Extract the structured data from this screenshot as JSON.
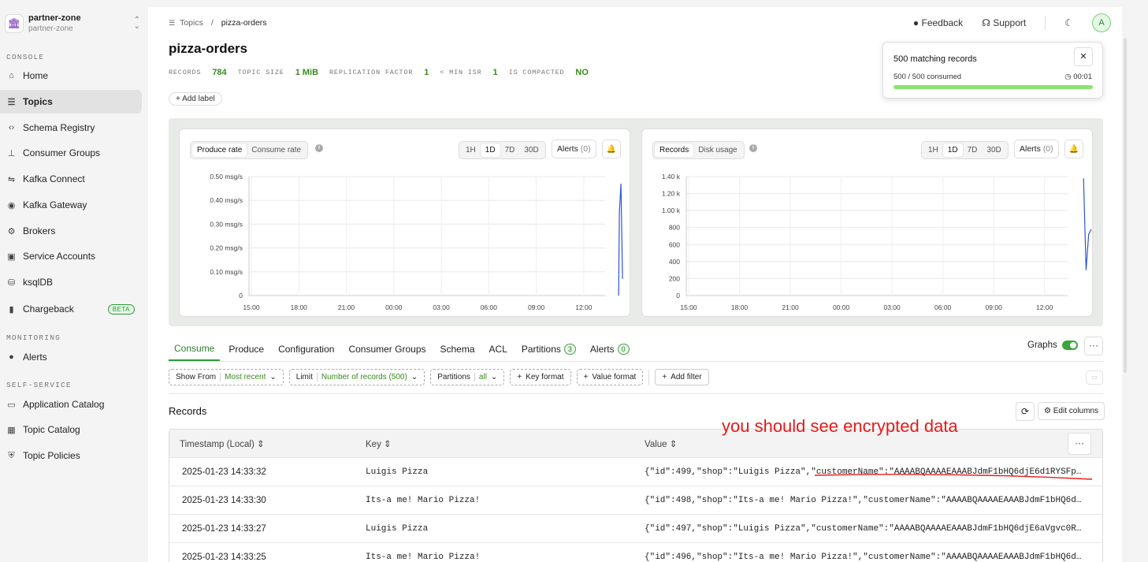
{
  "org": {
    "name": "partner-zone",
    "sub": "partner-zone"
  },
  "sidebar": {
    "console_label": "CONSOLE",
    "monitoring_label": "MONITORING",
    "selfservice_label": "SELF-SERVICE",
    "items": [
      {
        "label": "Home"
      },
      {
        "label": "Topics"
      },
      {
        "label": "Schema Registry"
      },
      {
        "label": "Consumer Groups"
      },
      {
        "label": "Kafka Connect"
      },
      {
        "label": "Kafka Gateway"
      },
      {
        "label": "Brokers"
      },
      {
        "label": "Service Accounts"
      },
      {
        "label": "ksqlDB"
      },
      {
        "label": "Chargeback",
        "badge": "BETA"
      },
      {
        "label": "Alerts"
      },
      {
        "label": "Application Catalog"
      },
      {
        "label": "Topic Catalog"
      },
      {
        "label": "Topic Policies"
      }
    ]
  },
  "breadcrumb": {
    "root": "Topics",
    "sep": "/",
    "current": "pizza-orders"
  },
  "header": {
    "feedback": "Feedback",
    "support": "Support",
    "avatar": "A"
  },
  "topic": {
    "title": "pizza-orders",
    "stats": [
      {
        "k": "RECORDS",
        "v": "784"
      },
      {
        "k": "TOPIC SIZE",
        "v": "1 MiB"
      },
      {
        "k": "REPLICATION FACTOR",
        "v": "1"
      },
      {
        "k": "< MIN ISR",
        "v": "1"
      },
      {
        "k": "IS COMPACTED",
        "v": "NO"
      }
    ],
    "add_label": "Add label"
  },
  "toast": {
    "title": "500 matching records",
    "consumed": "500 / 500 consumed",
    "time": "00:01",
    "progress": 1.0
  },
  "graph_left": {
    "tabs": [
      "Produce rate",
      "Consume rate"
    ],
    "ranges": [
      "1H",
      "1D",
      "7D",
      "30D"
    ],
    "alerts_label": "Alerts",
    "alerts_count": "(0)"
  },
  "graph_right": {
    "tabs": [
      "Records",
      "Disk usage"
    ],
    "ranges": [
      "1H",
      "1D",
      "7D",
      "30D"
    ],
    "alerts_label": "Alerts",
    "alerts_count": "(0)"
  },
  "chart_data": [
    {
      "type": "line",
      "title": "Produce rate",
      "x": [
        "15:00",
        "18:00",
        "21:00",
        "00:00",
        "03:00",
        "06:00",
        "09:00",
        "12:00"
      ],
      "ylim": [
        0,
        0.5
      ],
      "yticks": [
        "0",
        "0.10 msg/s",
        "0.20 msg/s",
        "0.30 msg/s",
        "0.40 msg/s",
        "0.50 msg/s"
      ],
      "series": [
        {
          "color": "#2f54d6",
          "points": [
            [
              14.2,
              0
            ],
            [
              14.25,
              0.35
            ],
            [
              14.35,
              0.47
            ],
            [
              14.45,
              0.07
            ]
          ]
        }
      ],
      "grid": true
    },
    {
      "type": "line",
      "title": "Records",
      "x": [
        "15:00",
        "18:00",
        "21:00",
        "00:00",
        "03:00",
        "06:00",
        "09:00",
        "12:00"
      ],
      "ylim": [
        0,
        1400
      ],
      "yticks": [
        "0",
        "200",
        "400",
        "600",
        "800",
        "1.00 k",
        "1.20 k",
        "1.40 k"
      ],
      "series": [
        {
          "color": "#2f54d6",
          "points": [
            [
              14.3,
              1380
            ],
            [
              14.45,
              300
            ],
            [
              14.6,
              720
            ],
            [
              14.75,
              780
            ]
          ]
        }
      ],
      "grid": true
    }
  ],
  "tabs": [
    {
      "label": "Consume",
      "active": true
    },
    {
      "label": "Produce"
    },
    {
      "label": "Configuration"
    },
    {
      "label": "Consumer Groups"
    },
    {
      "label": "Schema"
    },
    {
      "label": "ACL"
    },
    {
      "label": "Partitions",
      "count": "3"
    },
    {
      "label": "Alerts",
      "count": "0"
    }
  ],
  "graphs_toggle": "Graphs",
  "filters": {
    "show_from": {
      "label": "Show From",
      "value": "Most recent"
    },
    "limit": {
      "label": "Limit",
      "value": "Number of records (500)"
    },
    "partitions": {
      "label": "Partitions",
      "value": "all"
    },
    "key_format": "Key format",
    "value_format": "Value format",
    "add_filter": "Add filter"
  },
  "records": {
    "title": "Records",
    "edit_columns": "Edit columns",
    "columns": [
      "Timestamp (Local)",
      "Key",
      "Value"
    ],
    "rows": [
      {
        "ts": "2025-01-23 14:33:32",
        "key": "Luigis Pizza",
        "value": "{\"id\":499,\"shop\":\"Luigis Pizza\",\"customerName\":\"AAAABQAAAAEAAABJdmF1bHQ6djE6d1RYSFp…"
      },
      {
        "ts": "2025-01-23 14:33:30",
        "key": "Its-a me! Mario Pizza!",
        "value": "{\"id\":498,\"shop\":\"Its-a me! Mario Pizza!\",\"customerName\":\"AAAABQAAAAEAAABJdmF1bHQ6d…"
      },
      {
        "ts": "2025-01-23 14:33:27",
        "key": "Luigis Pizza",
        "value": "{\"id\":497,\"shop\":\"Luigis Pizza\",\"customerName\":\"AAAABQAAAAEAAABJdmF1bHQ6djE6aVgvc0R…"
      },
      {
        "ts": "2025-01-23 14:33:25",
        "key": "Its-a me! Mario Pizza!",
        "value": "{\"id\":496,\"shop\":\"Its-a me! Mario Pizza!\",\"customerName\":\"AAAABQAAAAEAAABJdmF1bHQ6d…"
      }
    ]
  },
  "annotation": "you should see encrypted data"
}
